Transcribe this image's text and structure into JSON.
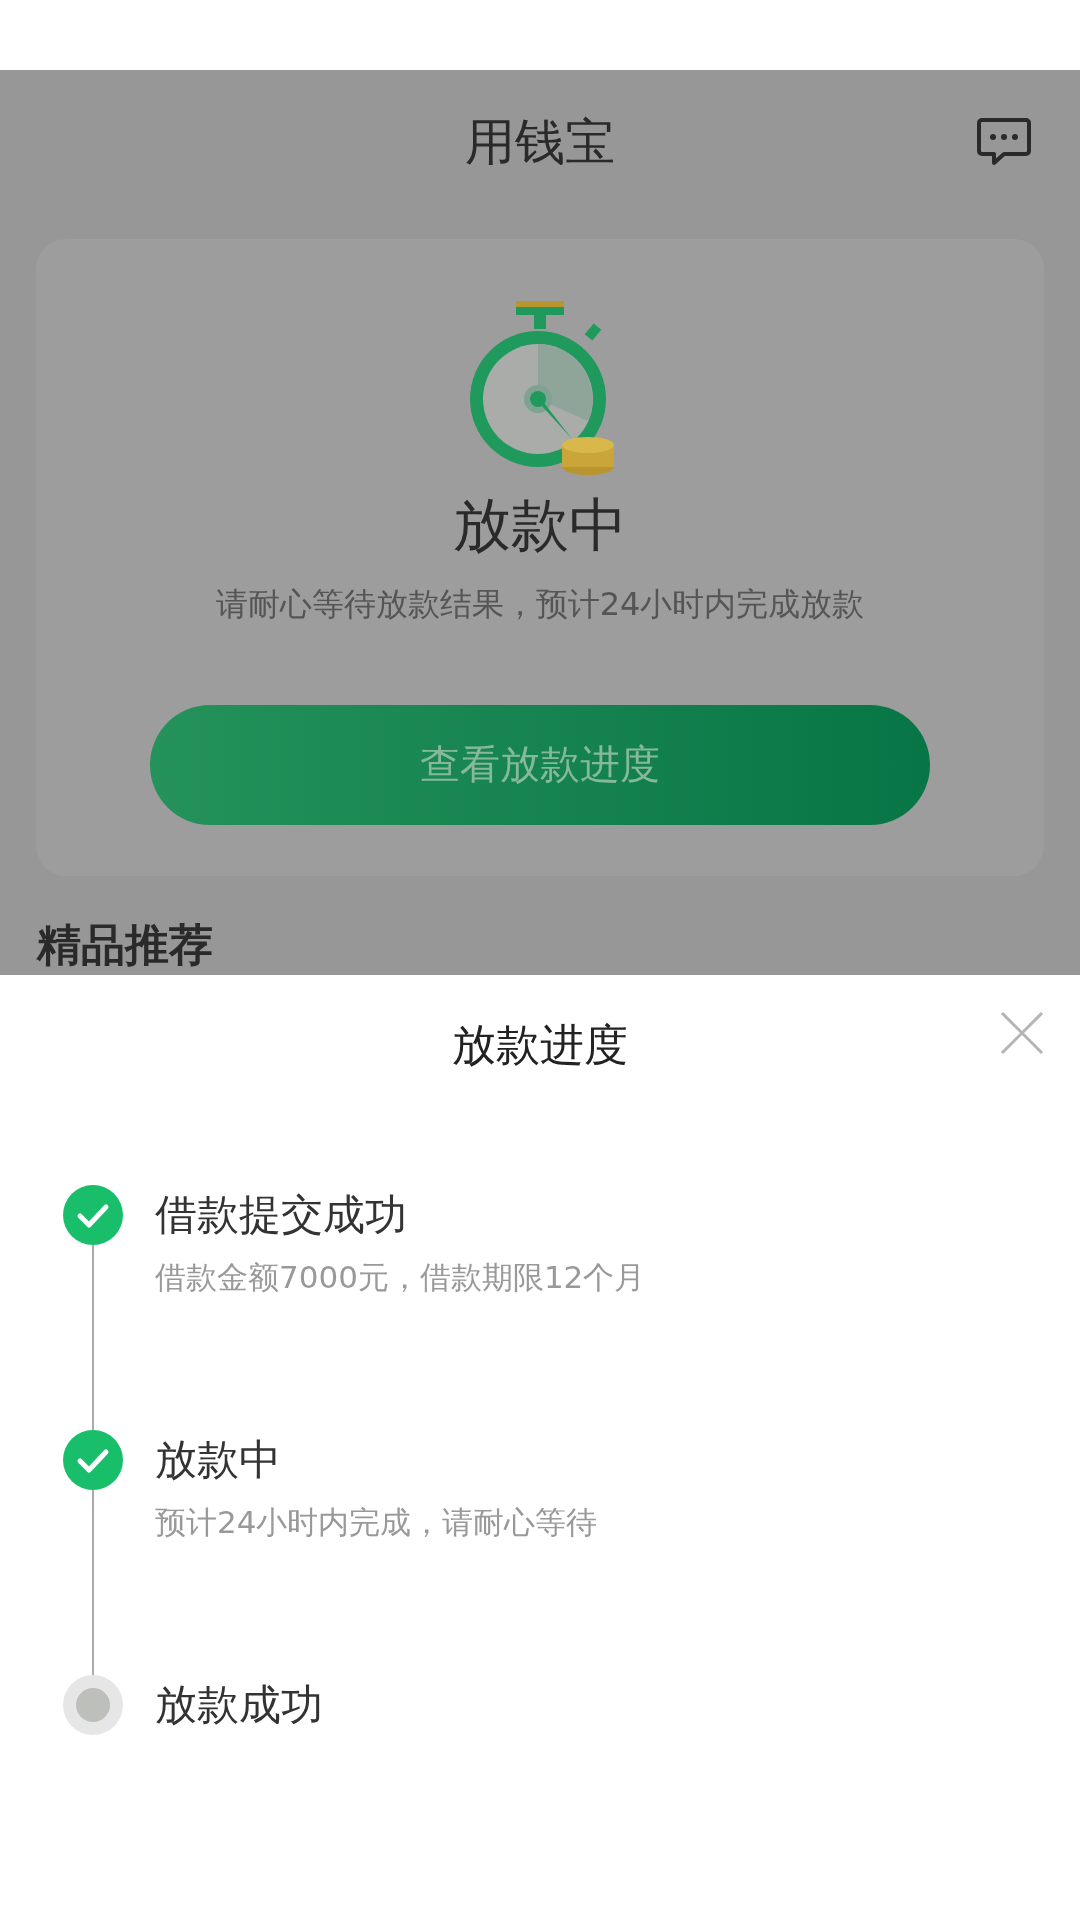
{
  "header": {
    "title": "用钱宝"
  },
  "status_card": {
    "title": "放款中",
    "subtitle": "请耐心等待放款结果，预计24小时内完成放款",
    "button": "查看放款进度"
  },
  "section_heading": "精品推荐",
  "sheet": {
    "title": "放款进度",
    "steps": [
      {
        "title": "借款提交成功",
        "description": "借款金额7000元，借款期限12个月",
        "done": true
      },
      {
        "title": "放款中",
        "description": "预计24小时内完成，请耐心等待",
        "done": true
      },
      {
        "title": "放款成功",
        "done": false
      }
    ]
  }
}
